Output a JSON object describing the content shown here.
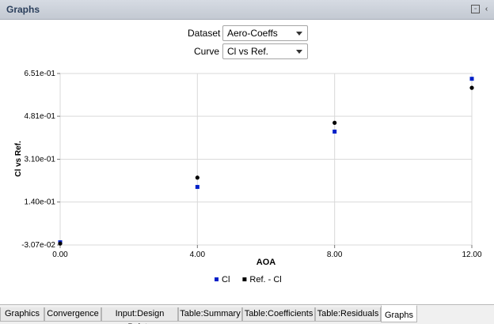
{
  "panel": {
    "title": "Graphs"
  },
  "controls": {
    "dataset_label": "Dataset",
    "dataset_value": "Aero-Coeffs",
    "curve_label": "Curve",
    "curve_value": "Cl vs Ref."
  },
  "chart_data": {
    "type": "scatter",
    "xlabel": "AOA",
    "ylabel": "Cl vs Ref.",
    "xlim": [
      0,
      12
    ],
    "ylim": [
      -0.0307,
      0.651
    ],
    "xticks": [
      0,
      4,
      8,
      12
    ],
    "xtick_labels": [
      "0.00",
      "4.00",
      "8.00",
      "12.00"
    ],
    "yticks": [
      -0.0307,
      0.14,
      0.31,
      0.481,
      0.651
    ],
    "ytick_labels": [
      "-3.07e-02",
      "1.40e-01",
      "3.10e-01",
      "4.81e-01",
      "6.51e-01"
    ],
    "grid": true,
    "legend_position": "bottom-center",
    "series": [
      {
        "name": "Cl",
        "color": "#0020c8",
        "marker": "square",
        "x": [
          0,
          4,
          8,
          12
        ],
        "y": [
          -0.02,
          0.2,
          0.42,
          0.63
        ]
      },
      {
        "name": "Ref. - Cl",
        "color": "#000000",
        "marker": "circle",
        "x": [
          0,
          4,
          8,
          12
        ],
        "y": [
          -0.025,
          0.237,
          0.455,
          0.594
        ]
      }
    ]
  },
  "tabs": [
    {
      "label": "Graphics",
      "active": false
    },
    {
      "label": "Convergence",
      "active": false
    },
    {
      "label": "Input:Design Points",
      "active": false
    },
    {
      "label": "Table:Summary",
      "active": false
    },
    {
      "label": "Table:Coefficients",
      "active": false
    },
    {
      "label": "Table:Residuals",
      "active": false
    },
    {
      "label": "Graphs",
      "active": true
    }
  ]
}
